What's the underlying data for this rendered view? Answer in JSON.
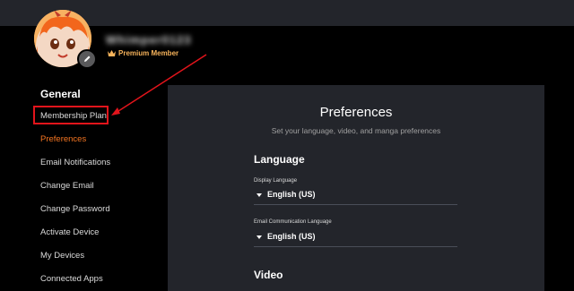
{
  "header": {
    "username": "Whimper0123",
    "membership_badge": "Premium Member",
    "crown_icon": "crown-icon",
    "edit_icon": "pencil-icon",
    "accent_color": "#f47521"
  },
  "sidebar": {
    "section_title": "General",
    "items": [
      {
        "label": "Membership Plan",
        "active": false
      },
      {
        "label": "Preferences",
        "active": true
      },
      {
        "label": "Email Notifications",
        "active": false
      },
      {
        "label": "Change Email",
        "active": false
      },
      {
        "label": "Change Password",
        "active": false
      },
      {
        "label": "Activate Device",
        "active": false
      },
      {
        "label": "My Devices",
        "active": false
      },
      {
        "label": "Connected Apps",
        "active": false
      }
    ]
  },
  "annotation": {
    "highlight_color": "#e2141b",
    "target": "Membership Plan"
  },
  "preferences": {
    "title": "Preferences",
    "subtitle": "Set your language, video, and manga preferences",
    "language_heading": "Language",
    "display_language": {
      "label": "Display Language",
      "value": "English (US)"
    },
    "email_language": {
      "label": "Email Communication Language",
      "value": "English (US)"
    },
    "video_heading": "Video"
  }
}
